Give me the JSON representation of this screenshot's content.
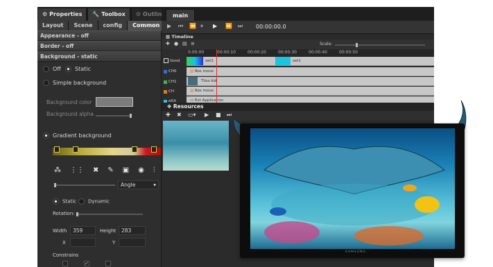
{
  "panel_tabs": [
    {
      "label": "Properties",
      "icon": "gear-icon"
    },
    {
      "label": "Toolbox",
      "icon": "wrench-icon"
    },
    {
      "label": "Outline",
      "icon": "gear-icon"
    }
  ],
  "sub_tabs": [
    "Layout",
    "Scene",
    "config",
    "Common"
  ],
  "sections": {
    "appearance": "Appearance - off",
    "border": "Border - off",
    "background": "Background - static"
  },
  "background": {
    "off": "Off",
    "static": "Static",
    "simple": "Simple background",
    "color_label": "Background color",
    "alpha_label": "Background alpha",
    "gradient": "Gradient background",
    "gradient_type": "Angle",
    "grad_static": "Static",
    "grad_dynamic": "Dynamic",
    "rotation": "Rotation:",
    "width_label": "Width",
    "width_value": "359",
    "height_label": "Height",
    "height_value": "283",
    "x_label": "X",
    "y_label": "Y",
    "constrains": "Constrains"
  },
  "main": {
    "tab": "main",
    "timecode": "00:00:00.0",
    "timeline_title": "Timeline",
    "scale_label": "Scale:",
    "ruler": [
      "0:00:00",
      "00:00:10",
      "00:00:20",
      "00:00:30",
      "00:00:40",
      "00:00:50"
    ],
    "tracks": [
      {
        "label": "Good",
        "clip1": "set1",
        "clip2": "set1"
      },
      {
        "label": "CH0",
        "clip1": "Ros move"
      },
      {
        "label": "CH1",
        "clip1": "Tilos kid"
      },
      {
        "label": "CH",
        "clip1": "Ros move"
      },
      {
        "label": "elUt",
        "clip1": "Ext Application"
      }
    ],
    "resources_title": "Resources"
  },
  "tv_brand": "SAMSUNG",
  "colors": {
    "accent_cyan": "#19c6e0",
    "gradient_red": "#c71b1b",
    "gradient_yellow": "#d8c54a"
  }
}
